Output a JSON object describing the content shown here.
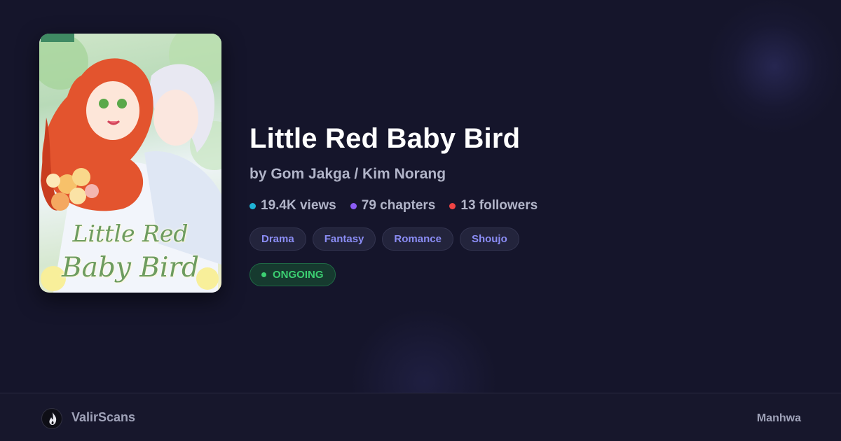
{
  "series": {
    "title": "Little Red Baby Bird",
    "byline": "by Gom Jakga / Kim Norang",
    "cover": {
      "title_line1": "Little Red",
      "title_line2": "Baby Bird"
    },
    "stats": [
      {
        "label": "19.4K views",
        "color": "#1fb3d6"
      },
      {
        "label": "79 chapters",
        "color": "#8b5cf6"
      },
      {
        "label": "13 followers",
        "color": "#ef4444"
      }
    ],
    "genres": [
      "Drama",
      "Fantasy",
      "Romance",
      "Shoujo"
    ],
    "status": "ONGOING",
    "type": "Manhwa"
  },
  "site": {
    "name": "ValirScans",
    "logo_icon": "flame-icon"
  },
  "colors": {
    "background": "#15152b",
    "genre_text": "#8b8df5",
    "status_green": "#3ccf72"
  }
}
